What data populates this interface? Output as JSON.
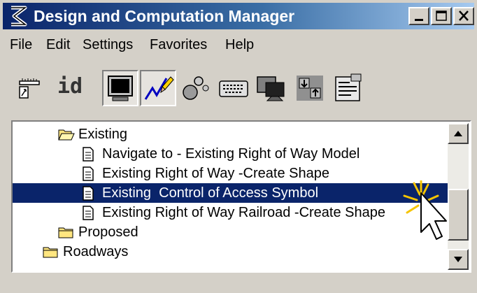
{
  "window": {
    "title": "Design and Computation Manager"
  },
  "menu": [
    "File",
    "Edit",
    "Settings",
    "Favorites",
    "Help"
  ],
  "toolbar": {
    "id_label": "id",
    "tools": [
      "ruler-icon",
      "id-icon",
      "monitor-icon",
      "pencil-icon",
      "nodes-icon",
      "keyboard-icon",
      "display-icon",
      "transfer-icon",
      "properties-icon"
    ]
  },
  "tree": {
    "items": [
      {
        "label": "Existing",
        "icon": "folder-open-icon"
      },
      {
        "label": "Navigate to - Existing Right of Way Model",
        "icon": "document-icon"
      },
      {
        "label": "Existing Right of Way -Create Shape",
        "icon": "document-icon"
      },
      {
        "label": "Existing  Control of Access Symbol",
        "icon": "document-icon",
        "selected": true
      },
      {
        "label": "Existing Right of Way Railroad -Create Shape",
        "icon": "document-icon"
      },
      {
        "label": "Proposed",
        "icon": "folder-icon"
      },
      {
        "label": "Roadways",
        "icon": "folder-icon"
      }
    ]
  },
  "colors": {
    "title_bar": "#0a246a",
    "selection": "#0a246a",
    "window_bg": "#d4d0c8"
  }
}
